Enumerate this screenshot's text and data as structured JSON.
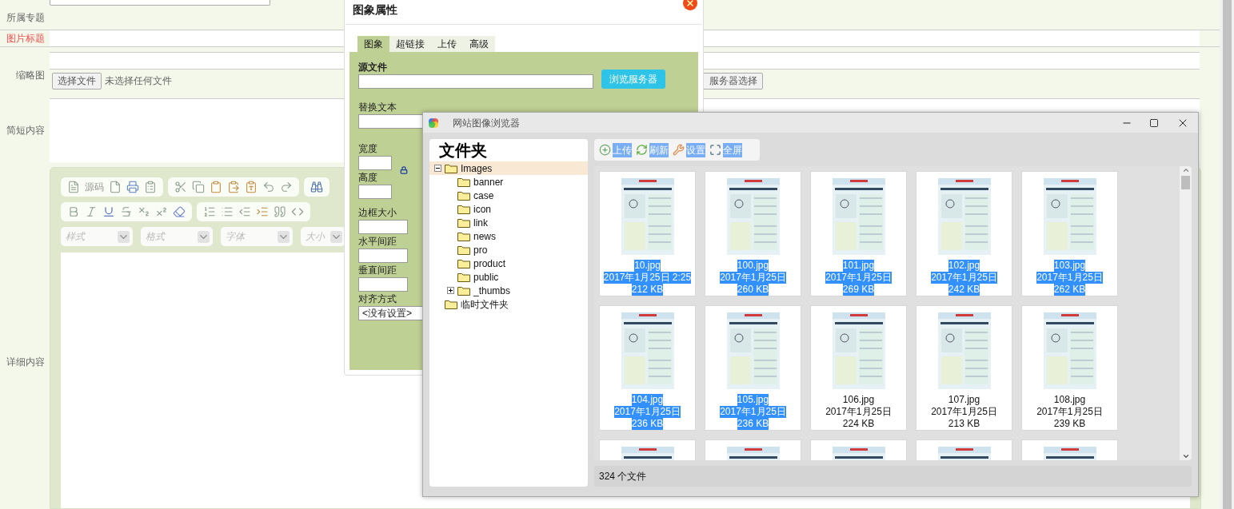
{
  "form": {
    "fields": [
      {
        "label": "所属专题",
        "kind": "blank",
        "required": false
      },
      {
        "label": "图片标题",
        "kind": "text",
        "required": true
      },
      {
        "label": "缩略图",
        "kind": "file",
        "required": false,
        "file_button": "选择文件",
        "file_status": "未选择任何文件",
        "server_button": "服务器选择"
      },
      {
        "label": "简短内容",
        "kind": "textarea",
        "required": false
      },
      {
        "label": "详细内容",
        "kind": "editor",
        "required": false
      }
    ]
  },
  "editor": {
    "source_button": "源码",
    "dropdowns": [
      "样式",
      "格式",
      "字体",
      "大小"
    ]
  },
  "image_dialog": {
    "title": "图象属性",
    "tabs": [
      {
        "label": "图象",
        "selected": true
      },
      {
        "label": "超链接",
        "selected": false
      },
      {
        "label": "上传",
        "selected": false
      },
      {
        "label": "高级",
        "selected": false
      }
    ],
    "source_label": "源文件",
    "browse_button": "浏览服务器",
    "alt_label": "替换文本",
    "size_fields": [
      {
        "label": "宽度"
      },
      {
        "label": "高度"
      }
    ],
    "spacing_fields": [
      {
        "label": "边框大小"
      },
      {
        "label": "水平间距"
      },
      {
        "label": "垂直间距"
      }
    ],
    "align_label": "对齐方式",
    "align_value": "<没有设置>"
  },
  "browser": {
    "title": "网站图像浏览器",
    "folder_heading": "文件夹",
    "folders": [
      {
        "name": "Images",
        "expanded": true,
        "selected": true,
        "children": [
          {
            "name": "banner",
            "selected": false
          },
          {
            "name": "case",
            "selected": false
          },
          {
            "name": "icon",
            "selected": false
          },
          {
            "name": "link",
            "selected": false
          },
          {
            "name": "news",
            "selected": false
          },
          {
            "name": "pro",
            "selected": false
          },
          {
            "name": "product",
            "selected": false
          },
          {
            "name": "public",
            "selected": false
          },
          {
            "name": "_thumbs",
            "expanded": false,
            "selected": false
          }
        ]
      },
      {
        "name": "临时文件夹",
        "selected": false
      }
    ],
    "toolbar": [
      {
        "kind": "upload",
        "label": "上传",
        "highlighted": true
      },
      {
        "kind": "refresh",
        "label": "刷新",
        "highlighted": true
      },
      {
        "kind": "settings",
        "label": "设置",
        "highlighted": true
      },
      {
        "kind": "fullscreen",
        "label": "全屏",
        "highlighted": true
      }
    ],
    "files": [
      {
        "name": "10.jpg",
        "date": "2017年1月25日 2:25",
        "size": "212 KB",
        "highlighted": true
      },
      {
        "name": "100.jpg",
        "date": "2017年1月25日",
        "size": "260 KB",
        "highlighted": true
      },
      {
        "name": "101.jpg",
        "date": "2017年1月25日",
        "size": "269 KB",
        "highlighted": true
      },
      {
        "name": "102.jpg",
        "date": "2017年1月25日",
        "size": "242 KB",
        "highlighted": true
      },
      {
        "name": "103.jpg",
        "date": "2017年1月25日",
        "size": "262 KB",
        "highlighted": true
      },
      {
        "name": "104.jpg",
        "date": "2017年1月25日",
        "size": "236 KB",
        "highlighted": true
      },
      {
        "name": "105.jpg",
        "date": "2017年1月25日",
        "size": "236 KB",
        "highlighted": true
      },
      {
        "name": "106.jpg",
        "date": "2017年1月25日",
        "size": "224 KB",
        "highlighted": false
      },
      {
        "name": "107.jpg",
        "date": "2017年1月25日",
        "size": "213 KB",
        "highlighted": false
      },
      {
        "name": "108.jpg",
        "date": "2017年1月25日",
        "size": "239 KB",
        "highlighted": false
      }
    ],
    "status": "324 个文件"
  }
}
